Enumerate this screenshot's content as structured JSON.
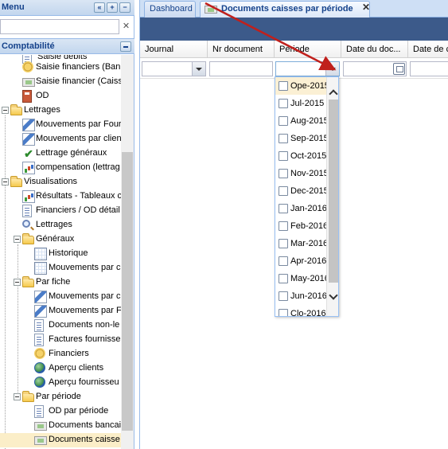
{
  "menu": {
    "title": "Menu"
  },
  "search": {
    "value": "",
    "clear_icon": "✕"
  },
  "section": {
    "title": "Comptabilité"
  },
  "tree": [
    {
      "label": "Saisie débits",
      "icon": "doc"
    },
    {
      "label": "Saisie financiers (Ban",
      "icon": "coins"
    },
    {
      "label": "Saisie financier (Caiss",
      "icon": "cash"
    },
    {
      "label": "OD",
      "icon": "calc"
    },
    {
      "label": "Lettrages",
      "icon": "folder"
    },
    {
      "label": "Mouvements par Four",
      "icon": "arrows"
    },
    {
      "label": "Mouvements par clien",
      "icon": "arrows"
    },
    {
      "label": "Lettrage généraux",
      "icon": "check"
    },
    {
      "label": "compensation (lettrag",
      "icon": "chart"
    },
    {
      "label": "Visualisations",
      "icon": "folder"
    },
    {
      "label": "Résultats - Tableaux c",
      "icon": "chart"
    },
    {
      "label": "Financiers / OD détail",
      "icon": "doc"
    },
    {
      "label": "Lettrages",
      "icon": "magnify"
    },
    {
      "label": "Généraux",
      "icon": "folder"
    },
    {
      "label": "Historique",
      "icon": "table"
    },
    {
      "label": "Mouvements par c",
      "icon": "table"
    },
    {
      "label": "Par fiche",
      "icon": "folder"
    },
    {
      "label": "Mouvements par c",
      "icon": "arrows"
    },
    {
      "label": "Mouvements par F",
      "icon": "arrows"
    },
    {
      "label": "Documents non-le",
      "icon": "doc"
    },
    {
      "label": "Factures fournisse",
      "icon": "doc"
    },
    {
      "label": "Financiers",
      "icon": "coins"
    },
    {
      "label": "Aperçu clients",
      "icon": "globe"
    },
    {
      "label": "Aperçu fournisseu",
      "icon": "globe"
    },
    {
      "label": "Par période",
      "icon": "folder"
    },
    {
      "label": "OD par période",
      "icon": "doc"
    },
    {
      "label": "Documents bancai",
      "icon": "cash"
    },
    {
      "label": "Documents caisse",
      "icon": "cash"
    }
  ],
  "tabs": [
    {
      "label": "Dashboard"
    },
    {
      "label": "Documents caisses par période",
      "close_icon": "✕"
    }
  ],
  "columns": [
    {
      "label": "Journal"
    },
    {
      "label": "Nr document"
    },
    {
      "label": "Période"
    },
    {
      "label": "Date du doc..."
    },
    {
      "label": "Date de c"
    }
  ],
  "period_options": [
    {
      "label": "Ope-2015"
    },
    {
      "label": "Jul-2015"
    },
    {
      "label": "Aug-2015"
    },
    {
      "label": "Sep-2015"
    },
    {
      "label": "Oct-2015"
    },
    {
      "label": "Nov-2015"
    },
    {
      "label": "Dec-2015"
    },
    {
      "label": "Jan-2016"
    },
    {
      "label": "Feb-2016"
    },
    {
      "label": "Mar-2016"
    },
    {
      "label": "Apr-2016"
    },
    {
      "label": "May-2016"
    },
    {
      "label": "Jun-2016"
    },
    {
      "label": "Clo-2016"
    }
  ],
  "colors": {
    "annotation_arrow": "#c0201c",
    "accent": "#15428b",
    "toolbar": "#3c5a8a"
  }
}
